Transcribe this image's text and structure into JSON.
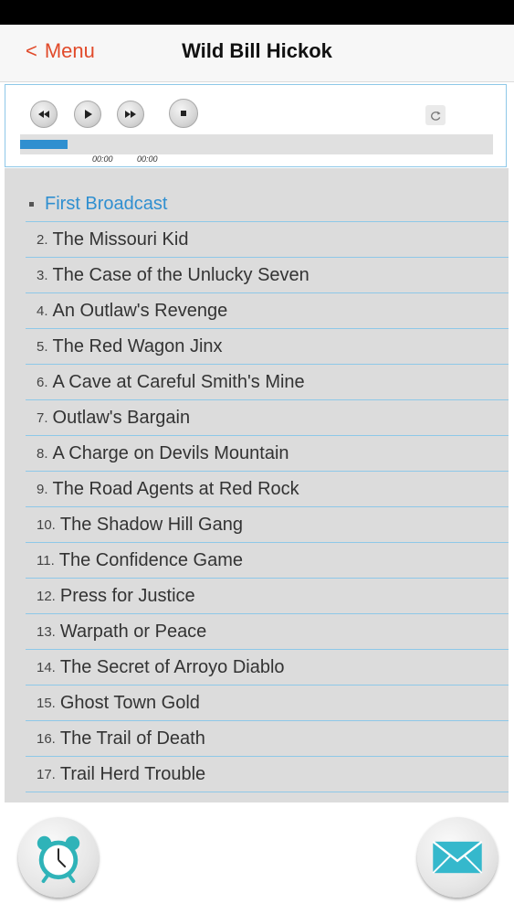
{
  "nav": {
    "back_label": "Menu",
    "title": "Wild Bill Hickok"
  },
  "player": {
    "elapsed": "00:00",
    "duration": "00:00",
    "progress_fraction": 0.1,
    "accent_color": "#2f8fd0"
  },
  "tracks": [
    {
      "number": "",
      "title": "First Broadcast",
      "current": true
    },
    {
      "number": "2.",
      "title": "The Missouri Kid"
    },
    {
      "number": "3.",
      "title": "The Case of the Unlucky Seven"
    },
    {
      "number": "4.",
      "title": "An Outlaw's Revenge"
    },
    {
      "number": "5.",
      "title": "The Red Wagon Jinx"
    },
    {
      "number": "6.",
      "title": "A Cave at Careful Smith's Mine"
    },
    {
      "number": "7.",
      "title": "Outlaw's Bargain"
    },
    {
      "number": "8.",
      "title": "A Charge on Devils Mountain"
    },
    {
      "number": "9.",
      "title": "The Road Agents at Red Rock"
    },
    {
      "number": "10.",
      "title": "The Shadow Hill Gang"
    },
    {
      "number": "11.",
      "title": "The Confidence Game"
    },
    {
      "number": "12.",
      "title": "Press for Justice"
    },
    {
      "number": "13.",
      "title": "Warpath or Peace"
    },
    {
      "number": "14.",
      "title": "The Secret of Arroyo Diablo"
    },
    {
      "number": "15.",
      "title": "Ghost Town Gold"
    },
    {
      "number": "16.",
      "title": "The Trail of Death"
    },
    {
      "number": "17.",
      "title": "Trail Herd Trouble"
    }
  ],
  "icons": {
    "back": "chevron-left-icon",
    "rewind": "rewind-icon",
    "play": "play-icon",
    "fast_forward": "fast-forward-icon",
    "stop": "stop-icon",
    "repeat": "repeat-icon",
    "alarm": "alarm-clock-icon",
    "mail": "envelope-icon"
  }
}
